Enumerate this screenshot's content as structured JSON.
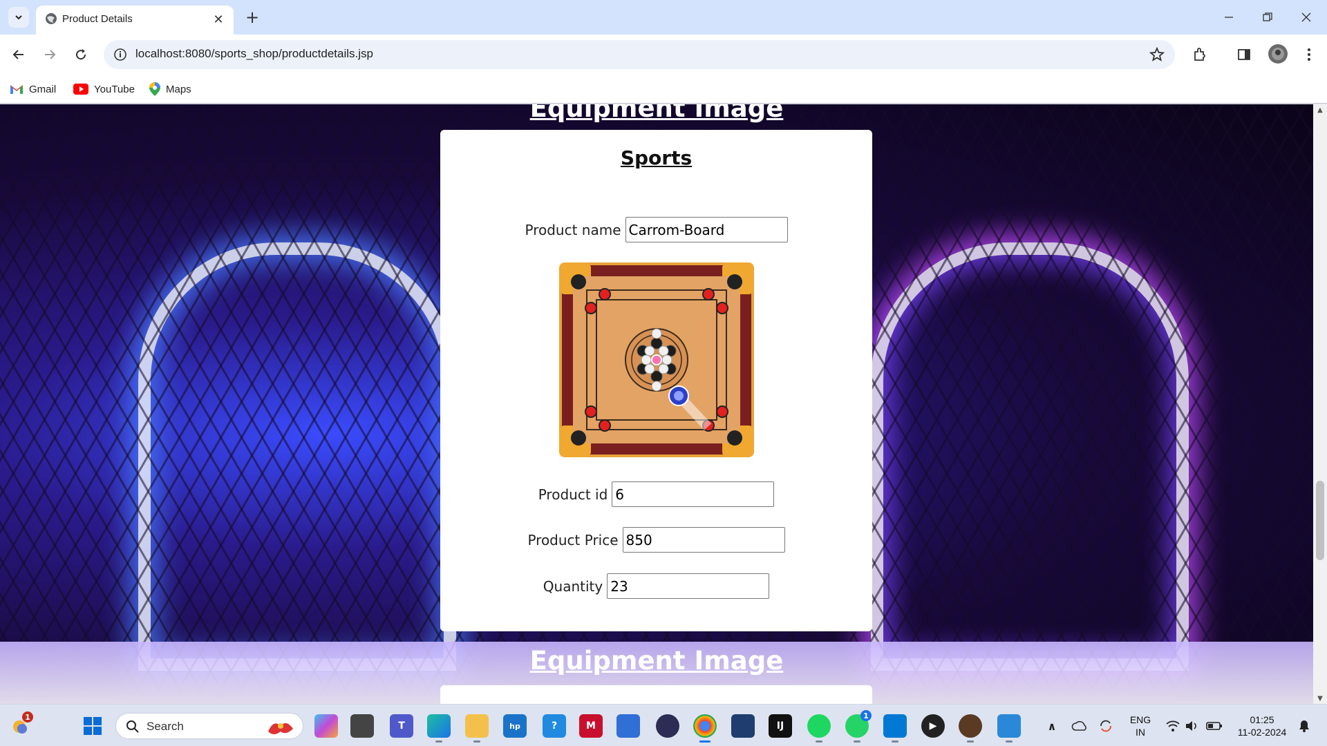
{
  "browser": {
    "tab_title": "Product Details",
    "new_tab_symbol": "+",
    "close_symbol": "✕",
    "url": "localhost:8080/sports_shop/productdetails.jsp",
    "bookmarks": [
      {
        "label": "Gmail",
        "icon": "gmail-icon"
      },
      {
        "label": "YouTube",
        "icon": "youtube-icon"
      },
      {
        "label": "Maps",
        "icon": "maps-icon"
      }
    ]
  },
  "page": {
    "section_heading": "Equipment Image",
    "card_title": "Sports",
    "product_name_label": "Product name",
    "product_name_value": "Carrom-Board",
    "product_image": "carrom-board-image",
    "product_id_label": "Product id",
    "product_id_value": "6",
    "product_price_label": "Product Price",
    "product_price_value": "850",
    "quantity_label": "Quantity",
    "quantity_value": "23"
  },
  "taskbar": {
    "search_label": "Search",
    "language_line1": "ENG",
    "language_line2": "IN",
    "time": "01:25",
    "date": "11-02-2024",
    "weather_badge": "1",
    "whatsapp_badge": "1"
  },
  "colors": {
    "tabbar": "#d3e3fd",
    "omnibox": "#edf2fa",
    "taskbar": "#dde3f0",
    "card": "#ffffff"
  }
}
